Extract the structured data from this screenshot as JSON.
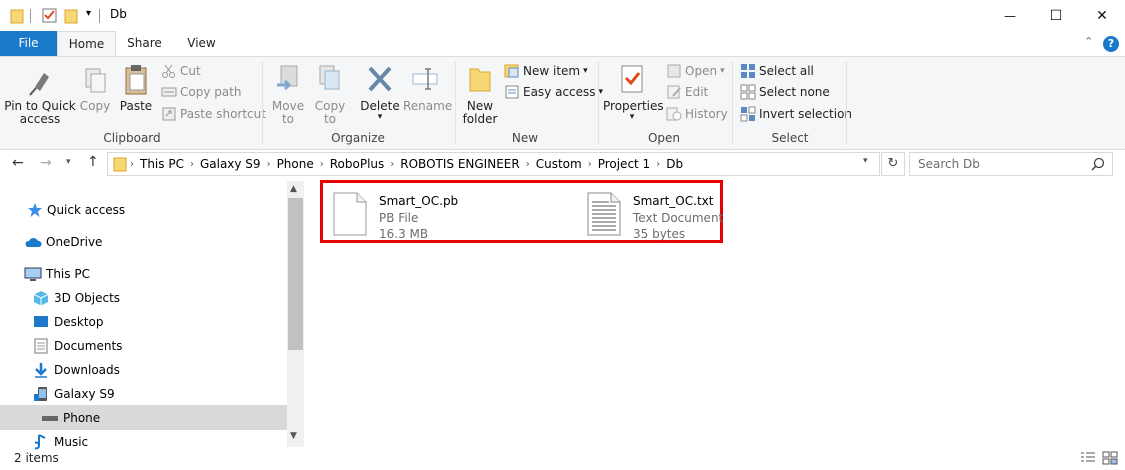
{
  "window": {
    "title": "Db",
    "minimize_glyph": "—",
    "maximize_glyph": "☐",
    "close_glyph": "✕"
  },
  "ribbon_tabs": [
    "File",
    "Home",
    "Share",
    "View"
  ],
  "ribbon": {
    "clipboard": {
      "label": "Clipboard",
      "pin": "Pin to Quick\naccess",
      "copy": "Copy",
      "paste": "Paste",
      "cut": "Cut",
      "copy_path": "Copy path",
      "paste_shortcut": "Paste shortcut"
    },
    "organize": {
      "label": "Organize",
      "move_to": "Move\nto",
      "copy_to": "Copy\nto",
      "delete": "Delete",
      "rename": "Rename"
    },
    "new": {
      "label": "New",
      "new_folder": "New\nfolder",
      "new_item": "New item",
      "easy_access": "Easy access"
    },
    "open": {
      "label": "Open",
      "properties": "Properties",
      "open": "Open",
      "edit": "Edit",
      "history": "History"
    },
    "select": {
      "label": "Select",
      "select_all": "Select all",
      "select_none": "Select none",
      "invert_selection": "Invert selection"
    }
  },
  "address": {
    "crumbs": [
      "This PC",
      "Galaxy S9",
      "Phone",
      "RoboPlus",
      "ROBOTIS ENGINEER",
      "Custom",
      "Project 1",
      "Db"
    ]
  },
  "search": {
    "placeholder": "Search Db"
  },
  "nav_pane": {
    "items": [
      {
        "label": "Quick access",
        "icon": "star-icon"
      },
      {
        "label": "OneDrive",
        "icon": "cloud-icon"
      },
      {
        "label": "This PC",
        "icon": "computer-icon"
      },
      {
        "label": "3D Objects",
        "icon": "cube-icon"
      },
      {
        "label": "Desktop",
        "icon": "desktop-icon"
      },
      {
        "label": "Documents",
        "icon": "documents-icon"
      },
      {
        "label": "Downloads",
        "icon": "download-icon"
      },
      {
        "label": "Galaxy S9",
        "icon": "phone-icon"
      },
      {
        "label": "Phone",
        "icon": "drive-icon"
      },
      {
        "label": "Music",
        "icon": "music-icon"
      }
    ]
  },
  "files": [
    {
      "name": "Smart_OC.pb",
      "type": "PB File",
      "size": "16.3 MB",
      "icon": "blank-file-icon"
    },
    {
      "name": "Smart_OC.txt",
      "type": "Text Document",
      "size": "35 bytes",
      "icon": "text-file-icon"
    }
  ],
  "status": {
    "item_count": "2 items"
  },
  "colors": {
    "accent": "#1979ca",
    "highlight": "#e60000",
    "selected_nav": "#d9d9d9"
  }
}
